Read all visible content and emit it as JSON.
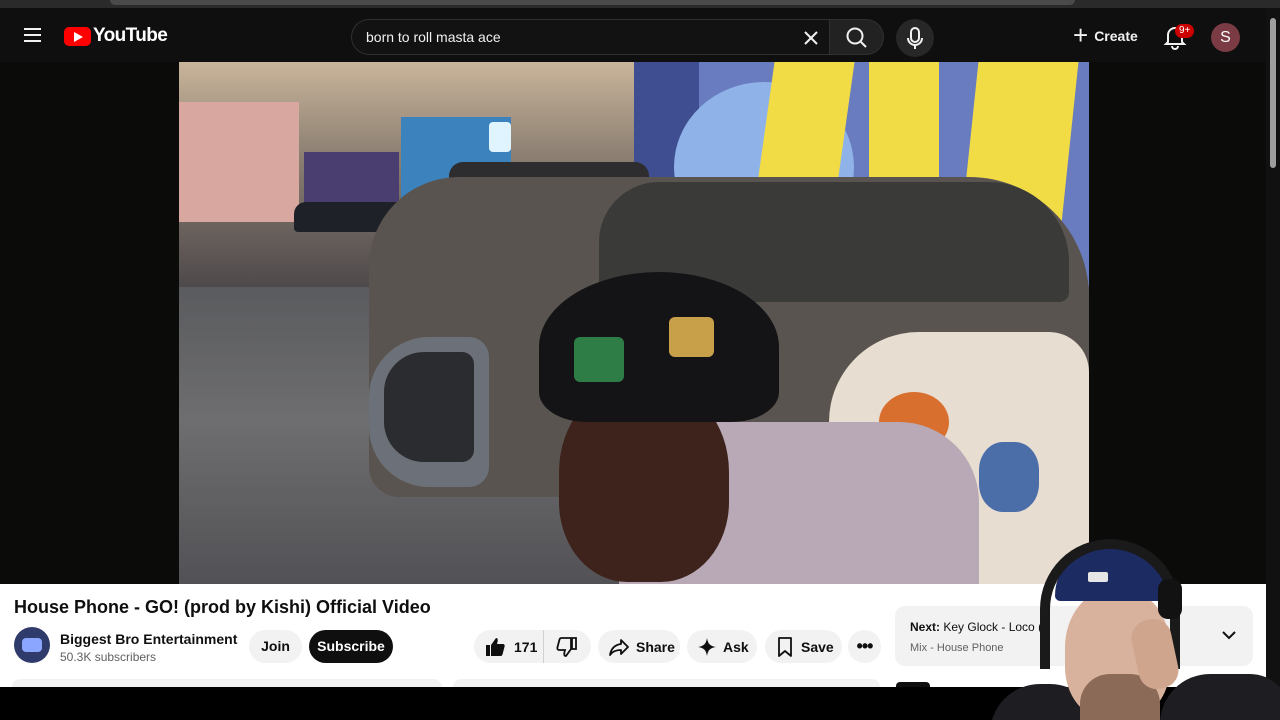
{
  "header": {
    "logo_text": "YouTube",
    "search": {
      "value": "born to roll masta ace"
    },
    "create_label": "Create",
    "notification_badge": "9+",
    "avatar_initial": "S"
  },
  "video": {
    "title": "House Phone - GO! (prod by Kishi) Official Video",
    "channel": {
      "name": "Biggest Bro Entertainment",
      "subscribers": "50.3K subscribers"
    },
    "join_label": "Join",
    "subscribe_label": "Subscribe",
    "actions": {
      "like_count": "171",
      "share_label": "Share",
      "ask_label": "Ask",
      "save_label": "Save",
      "more_label": "•••"
    }
  },
  "up_next": {
    "prefix": "Next:",
    "title": "Key Glock - Loco (",
    "subtitle": "Mix - House Phone"
  },
  "colors": {
    "brand_red": "#ff0000",
    "header_bg": "#0f0f0f",
    "badge_red": "#cc0000",
    "avatar_bg": "#7b3b44"
  },
  "icons": [
    "menu-icon",
    "youtube-logo-icon",
    "clear-icon",
    "search-icon",
    "mic-icon",
    "plus-icon",
    "bell-icon",
    "thumbs-up-icon",
    "thumbs-down-icon",
    "share-icon",
    "sparkle-icon",
    "bookmark-icon",
    "more-icon",
    "chevron-down-icon"
  ]
}
